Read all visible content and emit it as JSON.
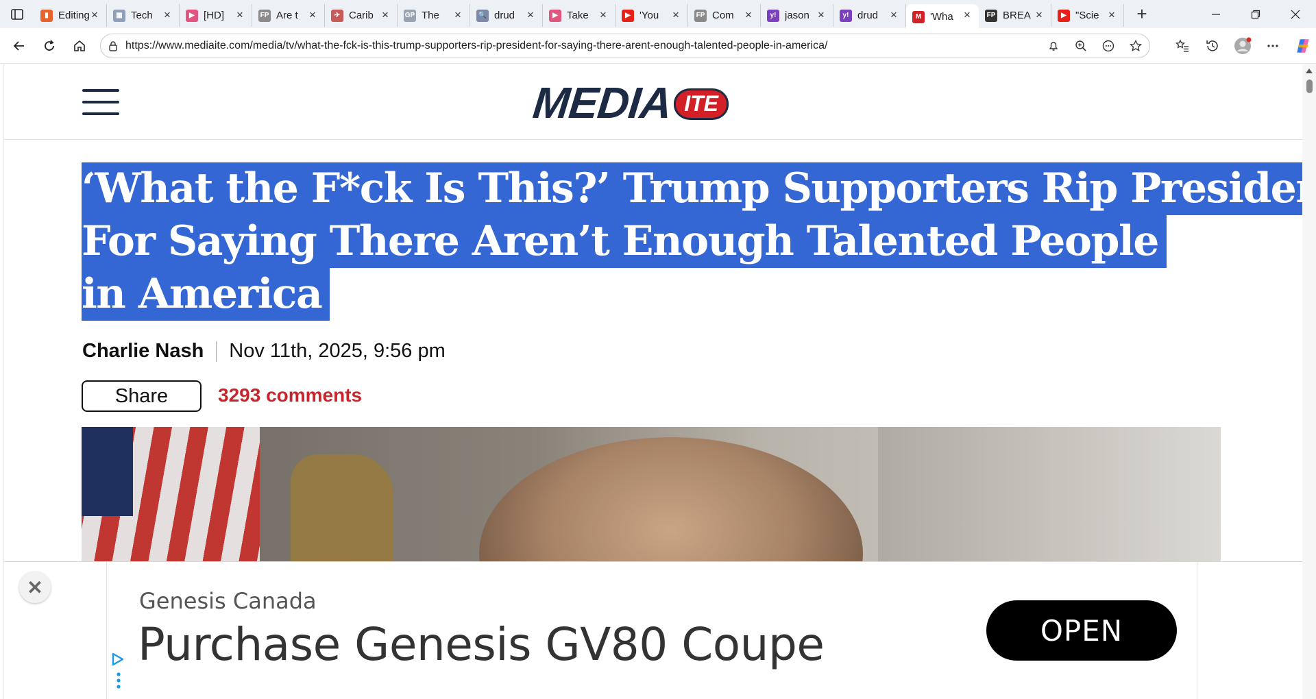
{
  "browser": {
    "tabs": [
      {
        "title": "Editing",
        "favicon_color": "#e8632b",
        "favicon_glyph": "▮"
      },
      {
        "title": "Tech",
        "favicon_color": "#8fa0b8",
        "favicon_glyph": "▦"
      },
      {
        "title": "[HD]",
        "favicon_color": "#e0567e",
        "favicon_glyph": "▶"
      },
      {
        "title": "Are t",
        "favicon_color": "#8a8a8a",
        "favicon_glyph": "FP"
      },
      {
        "title": "Carib",
        "favicon_color": "#c85a5a",
        "favicon_glyph": "✈"
      },
      {
        "title": "The",
        "favicon_color": "#9aa4b0",
        "favicon_glyph": "GP"
      },
      {
        "title": "drud",
        "favicon_color": "#7a8aa8",
        "favicon_glyph": "🔍"
      },
      {
        "title": "Take",
        "favicon_color": "#e0567e",
        "favicon_glyph": "▶"
      },
      {
        "title": "'You",
        "favicon_color": "#e62117",
        "favicon_glyph": "▶"
      },
      {
        "title": "Com",
        "favicon_color": "#8a8a8a",
        "favicon_glyph": "FP"
      },
      {
        "title": "jason",
        "favicon_color": "#7b3fc0",
        "favicon_glyph": "y!"
      },
      {
        "title": "drud",
        "favicon_color": "#7b3fc0",
        "favicon_glyph": "y!"
      },
      {
        "title": "'Wha",
        "favicon_color": "#d32027",
        "favicon_glyph": "M",
        "active": true
      },
      {
        "title": "BREA",
        "favicon_color": "#333333",
        "favicon_glyph": "FP"
      },
      {
        "title": "\"Scie",
        "favicon_color": "#e62117",
        "favicon_glyph": "▶"
      }
    ],
    "url": "https://www.mediaite.com/media/tv/what-the-fck-is-this-trump-supporters-rip-president-for-saying-there-arent-enough-talented-people-in-america/"
  },
  "site": {
    "logo_main": "MEDIA",
    "logo_badge": "ITE",
    "brand_navy": "#1d2a44",
    "brand_red": "#d32027"
  },
  "article": {
    "headline_lines": [
      "‘What the F*ck Is This?’ Trump Supporters Rip President",
      "For Saying There Aren’t Enough Talented People",
      "in America"
    ],
    "selection_color": "#3467d3",
    "author": "Charlie Nash",
    "date": "Nov 11th, 2025, 9:56 pm",
    "share_label": "Share",
    "comments_label": "3293 comments"
  },
  "ad": {
    "close_label": "✕",
    "advertiser": "Genesis Canada",
    "title": "Purchase Genesis GV80 Coupe",
    "cta": "OPEN"
  }
}
